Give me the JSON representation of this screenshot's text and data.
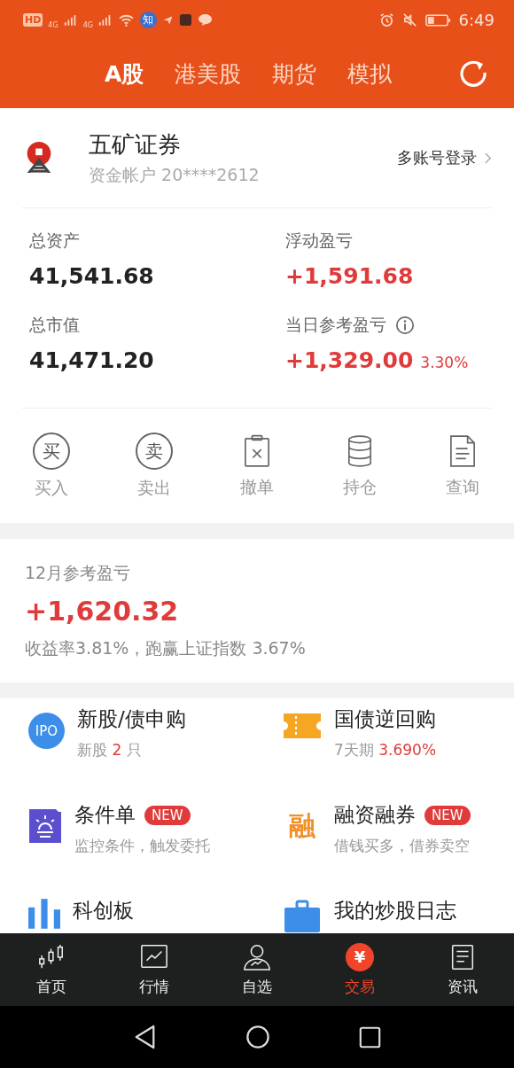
{
  "status_bar": {
    "network_badges": [
      "HD",
      "4G",
      "4G"
    ],
    "app_badge": "知",
    "time": "6:49"
  },
  "header": {
    "tabs": [
      {
        "label": "A股",
        "selected": true
      },
      {
        "label": "港美股",
        "selected": false
      },
      {
        "label": "期货",
        "selected": false
      },
      {
        "label": "模拟",
        "selected": false
      }
    ]
  },
  "account": {
    "broker": "五矿证券",
    "account_label": "资金帐户 20****2612",
    "multi_login": "多账号登录"
  },
  "stats": [
    {
      "label": "总资产",
      "value": "41,541.68",
      "gain": false
    },
    {
      "label": "浮动盈亏",
      "value": "+1,591.68",
      "gain": true
    },
    {
      "label": "总市值",
      "value": "41,471.20",
      "gain": false
    },
    {
      "label": "当日参考盈亏",
      "value": "+1,329.00",
      "gain": true,
      "percent": "3.30%",
      "info": true
    }
  ],
  "actions": [
    {
      "label": "买入",
      "kind": "circle",
      "glyph": "买"
    },
    {
      "label": "卖出",
      "kind": "circle",
      "glyph": "卖"
    },
    {
      "label": "撤单",
      "kind": "cancel"
    },
    {
      "label": "持仓",
      "kind": "stack"
    },
    {
      "label": "查询",
      "kind": "document"
    }
  ],
  "monthly": {
    "title": "12月参考盈亏",
    "value": "+1,620.32",
    "summary": "收益率3.81%，跑赢上证指数 3.67%"
  },
  "services": [
    {
      "kind": "ipo",
      "icon_text": "IPO",
      "title": "新股/债申购",
      "subtitle": [
        {
          "text": "新股 ",
          "highlight": false
        },
        {
          "text": "2",
          "highlight": true
        },
        {
          "text": " 只",
          "highlight": false
        }
      ]
    },
    {
      "kind": "ticket",
      "title": "国债逆回购",
      "subtitle": [
        {
          "text": "7天期 ",
          "highlight": false
        },
        {
          "text": "3.690%",
          "highlight": true
        }
      ]
    },
    {
      "kind": "bulb",
      "title": "条件单",
      "badge": "NEW",
      "subtitle": [
        {
          "text": "监控条件，触发委托",
          "highlight": false
        }
      ]
    },
    {
      "kind": "char",
      "icon_text": "融",
      "title": "融资融券",
      "badge": "NEW",
      "subtitle": [
        {
          "text": "借钱买多，借券卖空",
          "highlight": false
        }
      ]
    },
    {
      "kind": "bars",
      "title": "科创板"
    },
    {
      "kind": "journal",
      "title": "我的炒股日志"
    }
  ],
  "bottom_nav": [
    {
      "label": "首页",
      "kind": "candles",
      "selected": false
    },
    {
      "label": "行情",
      "kind": "chart",
      "selected": false
    },
    {
      "label": "自选",
      "kind": "person",
      "selected": false
    },
    {
      "label": "交易",
      "kind": "yen",
      "icon_text": "¥",
      "selected": true
    },
    {
      "label": "资讯",
      "kind": "news",
      "selected": false
    }
  ]
}
